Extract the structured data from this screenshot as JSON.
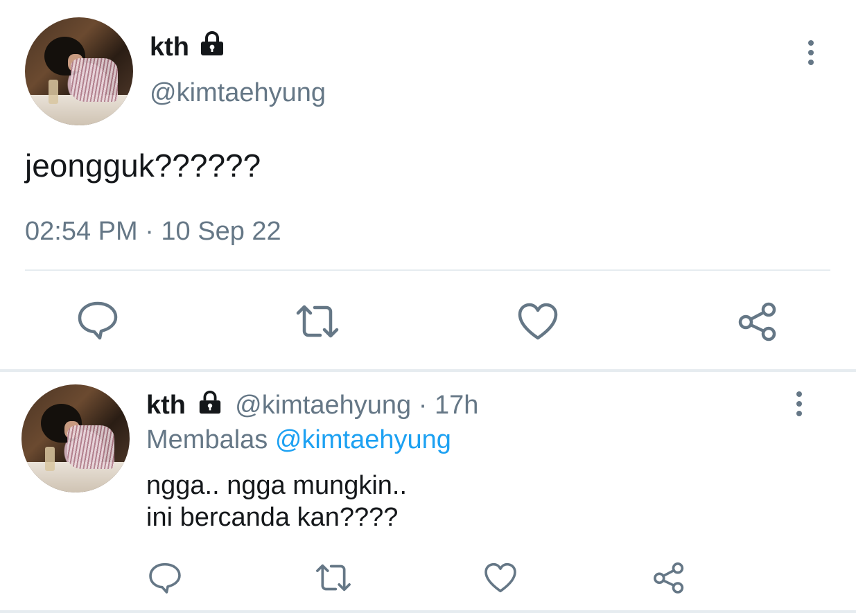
{
  "main_tweet": {
    "display_name": "kth",
    "handle": "@kimtaehyung",
    "text": "jeongguk??????",
    "timestamp": "02:54 PM · 10 Sep 22"
  },
  "reply": {
    "display_name": "kth",
    "handle": "@kimtaehyung",
    "separator": "·",
    "age": "17h",
    "replying_label": "Membalas",
    "replying_to": "@kimtaehyung",
    "line1": "ngga.. ngga mungkin..",
    "line2": "ini bercanda kan????"
  },
  "icons": {
    "lock": "lock-icon",
    "more": "more-vertical-icon",
    "reply": "reply-icon",
    "retweet": "retweet-icon",
    "like": "heart-icon",
    "share": "share-icon"
  },
  "colors": {
    "text": "#14171a",
    "muted": "#657786",
    "link": "#1da1f2",
    "divider": "#e6ecf0"
  }
}
